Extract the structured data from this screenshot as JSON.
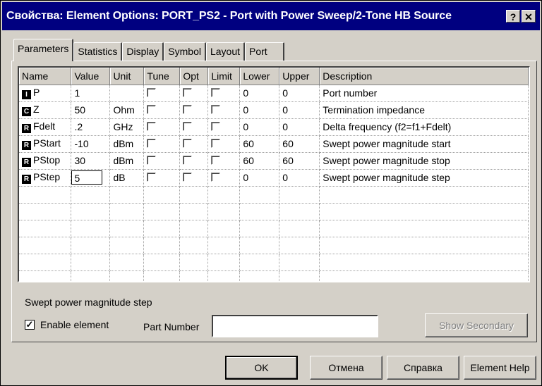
{
  "window": {
    "title": "Свойства: Element Options: PORT_PS2 - Port with Power Sweep/2-Tone HB Source",
    "help_btn": "?",
    "close_btn": "✕"
  },
  "tabs": [
    "Parameters",
    "Statistics",
    "Display",
    "Symbol",
    "Layout",
    "Port"
  ],
  "grid": {
    "columns": [
      "Name",
      "Value",
      "Unit",
      "Tune",
      "Opt",
      "Limit",
      "Lower",
      "Upper",
      "Description"
    ],
    "rows": [
      {
        "type": "I",
        "name": "P",
        "value": "1",
        "unit": "",
        "lower": "0",
        "upper": "0",
        "description": "Port number"
      },
      {
        "type": "C",
        "name": "Z",
        "value": "50",
        "unit": "Ohm",
        "lower": "0",
        "upper": "0",
        "description": "Termination impedance"
      },
      {
        "type": "R",
        "name": "Fdelt",
        "value": ".2",
        "unit": "GHz",
        "lower": "0",
        "upper": "0",
        "description": "Delta frequency (f2=f1+Fdelt)"
      },
      {
        "type": "R",
        "name": "PStart",
        "value": "-10",
        "unit": "dBm",
        "lower": "60",
        "upper": "60",
        "description": "Swept power magnitude start"
      },
      {
        "type": "R",
        "name": "PStop",
        "value": "30",
        "unit": "dBm",
        "lower": "60",
        "upper": "60",
        "description": "Swept power magnitude stop"
      },
      {
        "type": "R",
        "name": "PStep",
        "value": "5",
        "unit": "dB",
        "lower": "0",
        "upper": "0",
        "description": "Swept power magnitude step"
      }
    ]
  },
  "status_description": "Swept power magnitude step",
  "enable_element": {
    "label": "Enable element",
    "checked": "✓"
  },
  "part_number": {
    "label": "Part Number",
    "value": ""
  },
  "buttons": {
    "show_secondary": "Show Secondary",
    "ok": "OK",
    "cancel": "Отмена",
    "help": "Справка",
    "element_help": "Element Help"
  }
}
